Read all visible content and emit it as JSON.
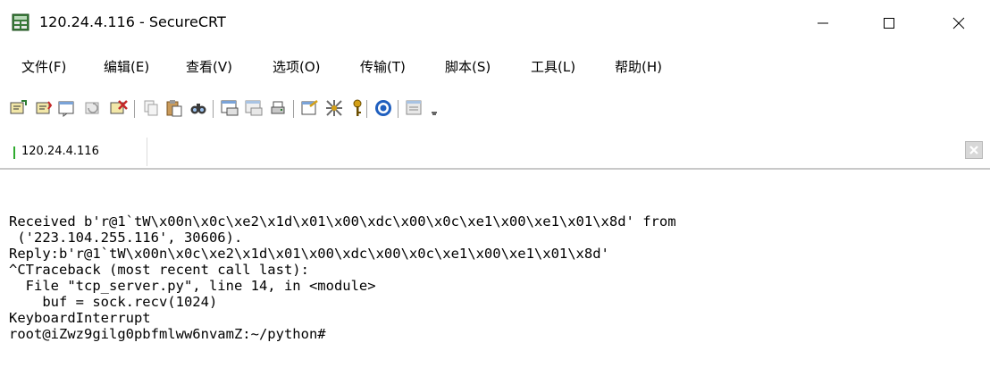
{
  "window": {
    "title": "120.24.4.116 - SecureCRT",
    "minimize_icon": "minimize-icon",
    "maximize_icon": "maximize-icon",
    "close_icon": "close-icon"
  },
  "menu": {
    "items": [
      "文件(F)",
      "编辑(E)",
      "查看(V)",
      "选项(O)",
      "传输(T)",
      "脚本(S)",
      "工具(L)",
      "帮助(H)"
    ]
  },
  "toolbar": {
    "icons": [
      "connect-icon",
      "quick-connect-icon",
      "connect-tab-icon",
      "reconnect-icon",
      "disconnect-icon",
      "copy-icon",
      "paste-icon",
      "find-icon",
      "print-icon",
      "print-selection-icon",
      "print-setup-icon",
      "session-options-icon",
      "global-options-icon",
      "keymap-icon",
      "help-icon",
      "log-session-icon",
      "more-icon"
    ]
  },
  "tabs": {
    "active_label": "120.24.4.116",
    "status_color": "#2eaa2e"
  },
  "terminal": {
    "lines": [
      "Received b'r@1`tW\\x00n\\x0c\\xe2\\x1d\\x01\\x00\\xdc\\x00\\x0c\\xe1\\x00\\xe1\\x01\\x8d' from",
      " ('223.104.255.116', 30606).",
      "Reply:b'r@1`tW\\x00n\\x0c\\xe2\\x1d\\x01\\x00\\xdc\\x00\\x0c\\xe1\\x00\\xe1\\x01\\x8d'",
      "^CTraceback (most recent call last):",
      "  File \"tcp_server.py\", line 14, in <module>",
      "    buf = sock.recv(1024)",
      "KeyboardInterrupt",
      "root@iZwz9gilg0pbfmlww6nvamZ:~/python#"
    ]
  }
}
